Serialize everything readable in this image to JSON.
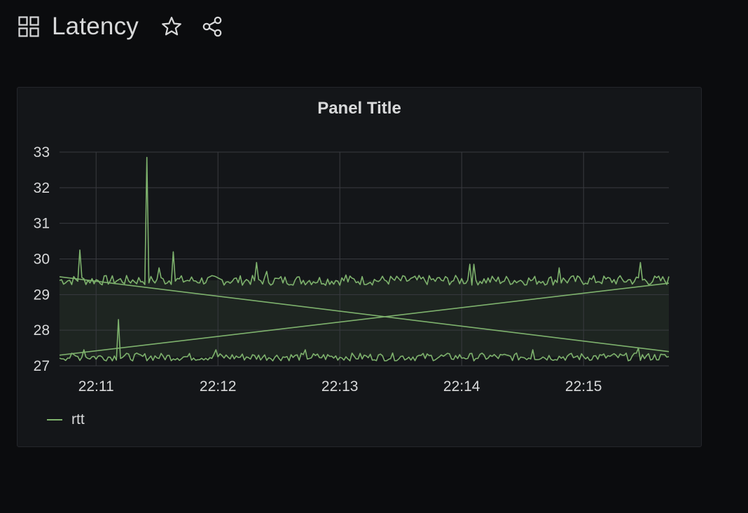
{
  "dashboard": {
    "title": "Latency",
    "icons": {
      "dashboard": "dashboard-grid-icon",
      "star": "star-icon",
      "share": "share-icon"
    }
  },
  "panel": {
    "title": "Panel Title",
    "legend": [
      {
        "label": "rtt",
        "color": "#7eb26d"
      }
    ]
  },
  "chart_data": {
    "type": "line",
    "title": "Panel Title",
    "ylim": [
      27,
      33
    ],
    "y_ticks": [
      "27",
      "28",
      "29",
      "30",
      "31",
      "32",
      "33"
    ],
    "x_ticks": [
      "22:11",
      "22:12",
      "22:13",
      "22:14",
      "22:15"
    ],
    "x_tick_minutes": [
      11,
      12,
      13,
      14,
      15
    ],
    "xlim_minutes": [
      10.7,
      15.7
    ],
    "grid": true,
    "legend_position": "bottom-left",
    "series": [
      {
        "name": "rtt",
        "color": "#7eb26d",
        "fill": true,
        "upper_baseline": 29.4,
        "lower_baseline": 27.25,
        "upper_spikes": [
          [
            10.86,
            30.25
          ],
          [
            11.42,
            32.85
          ],
          [
            11.52,
            29.75
          ],
          [
            11.63,
            30.2
          ],
          [
            12.32,
            29.9
          ],
          [
            12.4,
            29.65
          ],
          [
            13.05,
            29.55
          ],
          [
            14.06,
            29.85
          ],
          [
            14.1,
            29.85
          ],
          [
            14.8,
            29.75
          ],
          [
            15.46,
            29.9
          ]
        ],
        "lower_spikes": [
          [
            10.9,
            27.45
          ],
          [
            11.19,
            28.3
          ],
          [
            11.98,
            27.45
          ],
          [
            12.71,
            27.45
          ],
          [
            14.59,
            27.45
          ],
          [
            15.45,
            27.5
          ]
        ],
        "diagonal_down": [
          [
            10.7,
            29.5
          ],
          [
            15.7,
            27.4
          ]
        ],
        "diagonal_up": [
          [
            10.7,
            27.3
          ],
          [
            15.7,
            29.32
          ]
        ]
      }
    ]
  }
}
